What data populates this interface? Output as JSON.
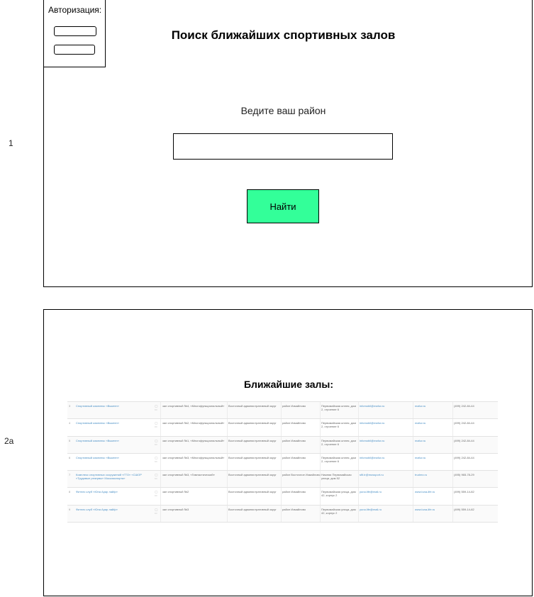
{
  "labels": {
    "row1": "1",
    "row2": "2а"
  },
  "auth": {
    "title": "Авторизация:"
  },
  "search": {
    "title": "Поиск ближайших спортивных залов",
    "prompt": "Ведите ваш район",
    "input_value": "",
    "button": "Найти"
  },
  "results": {
    "title": "Ближайшие залы:",
    "rows": [
      {
        "num": "3",
        "name": "Спортивный комплекс «Выкепн»",
        "icons": "◯ ▭",
        "hall": "зал спортивный №4, «Многофункциональный»",
        "adm": "Восточный административный округ",
        "district": "район Измайлово",
        "address": "Первомайская аллея, дом 2, строение 6",
        "email": "infomobil@mafuv.ru",
        "site": "mafuv.ru",
        "phone": "(499) 242-84-44"
      },
      {
        "num": "4",
        "name": "Спортивный комплекс «Выкепн»",
        "icons": "◯ ▭",
        "hall": "зал спортивный №2, «Многофункциональный»",
        "adm": "Восточный административный округ",
        "district": "район Измайлово",
        "address": "Первомайская аллея, дом 2, строение 6",
        "email": "infomobil@mafuv.ru",
        "site": "mafuv.ru",
        "phone": "(499) 242-84-44"
      },
      {
        "num": "5",
        "name": "Спортивный комплекс «Выкепн»",
        "icons": "◯ ▭",
        "hall": "зал спортивный №1, «Многофункциональный»",
        "adm": "Восточный административный округ",
        "district": "район Измайлово",
        "address": "Первомайская аллея, дом 2, строение 6",
        "email": "infomobil@mafuv.ru",
        "site": "mafuv.ru",
        "phone": "(499) 242-84-44"
      },
      {
        "num": "6",
        "name": "Спортивный комплекс «Выкепн»",
        "icons": "◯ ▭",
        "hall": "зал спортивный №3, «Многофункциональный»",
        "adm": "Восточный административный округ",
        "district": "район Измайлово",
        "address": "Первомайская аллея, дом 2, строение 6",
        "email": "infomobil@mafuv.ru",
        "site": "mafuv.ru",
        "phone": "(499) 242-84-44"
      },
      {
        "num": "7",
        "name": "Комплекс спортивных сооружений «ГТО» «СШОР «Трудовые резервы» Москомспорта»",
        "icons": "◯ ▭",
        "hall": "зал спортивный №3, «Гимнастический»",
        "adm": "Восточный административный округ",
        "district": "район Восточное Измайлово",
        "address": "Нижняя Первомайская улица, дом 52",
        "email": "sflt.tr@mossport.ru",
        "site": "trudrez.ru",
        "phone": "(495) 965-78-29"
      },
      {
        "num": "8",
        "name": "Фитнес клуб «Юна Арар лайф»",
        "icons": "◯ ▭",
        "hall": "зал спортивный №2",
        "adm": "Восточный административный округ",
        "district": "район Измайлово",
        "address": "Первомайская улица, дом 42, корпус 2",
        "email": "yuna.life@mail.ru",
        "site": "www.luna-life.ru",
        "phone": "(499) 559-14-82"
      },
      {
        "num": "9",
        "name": "Фитнес клуб «Юна Арар лайф»",
        "icons": "◯ ▭",
        "hall": "зал спортивный №3",
        "adm": "Восточный административный округ",
        "district": "район Измайлово",
        "address": "Первомайская улица, дом 42, корпус 2",
        "email": "yuna.life@mail.ru",
        "site": "www.luna-life.ru",
        "phone": "(499) 559-14-82"
      }
    ]
  },
  "colors": {
    "find_button": "#33ff99",
    "link": "#4a90c6"
  }
}
